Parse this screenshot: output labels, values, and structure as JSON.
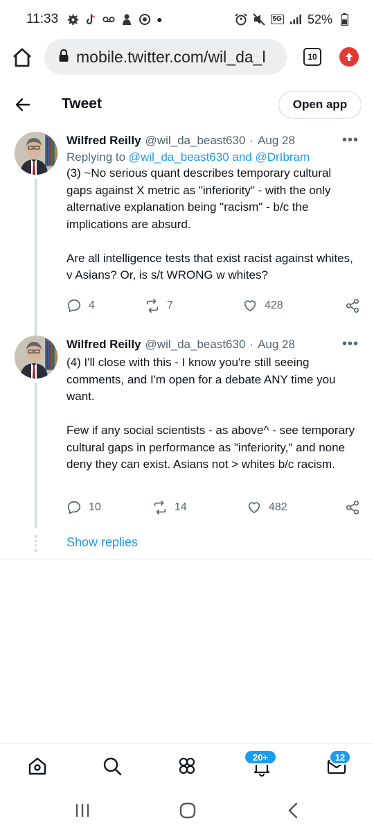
{
  "status_bar": {
    "time": "11:33",
    "battery": "52%",
    "network": "5G"
  },
  "browser": {
    "url": "mobile.twitter.com/wil_da_l",
    "tab_count": "10"
  },
  "header": {
    "title": "Tweet",
    "open_app_label": "Open app"
  },
  "tweets": [
    {
      "author": "Wilfred Reilly",
      "handle": "@wil_da_beast630",
      "separator": "·",
      "date": "Aug 28",
      "replying_prefix": "Replying to",
      "replying_to": "@wil_da_beast630 and @DrIbram",
      "paragraphs": [
        "(3) ~No serious quant describes temporary cultural gaps against X metric as \"inferiority\" - with the only alternative explanation being \"racism\" - b/c the implications are absurd.",
        "Are all intelligence tests that exist racist against whites, v Asians? Or, is s/t WRONG w whites?"
      ],
      "replies": "4",
      "retweets": "7",
      "likes": "428"
    },
    {
      "author": "Wilfred Reilly",
      "handle": "@wil_da_beast630",
      "separator": "·",
      "date": "Aug 28",
      "paragraphs": [
        "(4) I'll close with this - I know you're still seeing comments, and I'm open for a debate ANY time you want.",
        "Few if any social scientists - as above^ - see temporary cultural gaps in performance as \"inferiority,\" and none deny they can exist. Asians not > whites b/c racism."
      ],
      "replies": "10",
      "retweets": "14",
      "likes": "482"
    }
  ],
  "show_replies_label": "Show replies",
  "bottom_nav": {
    "notifications_badge": "20+",
    "messages_badge": "12"
  },
  "colors": {
    "accent": "#1d9bf0",
    "text": "#0f1419",
    "muted": "#536471",
    "update_icon": "#e53935"
  }
}
